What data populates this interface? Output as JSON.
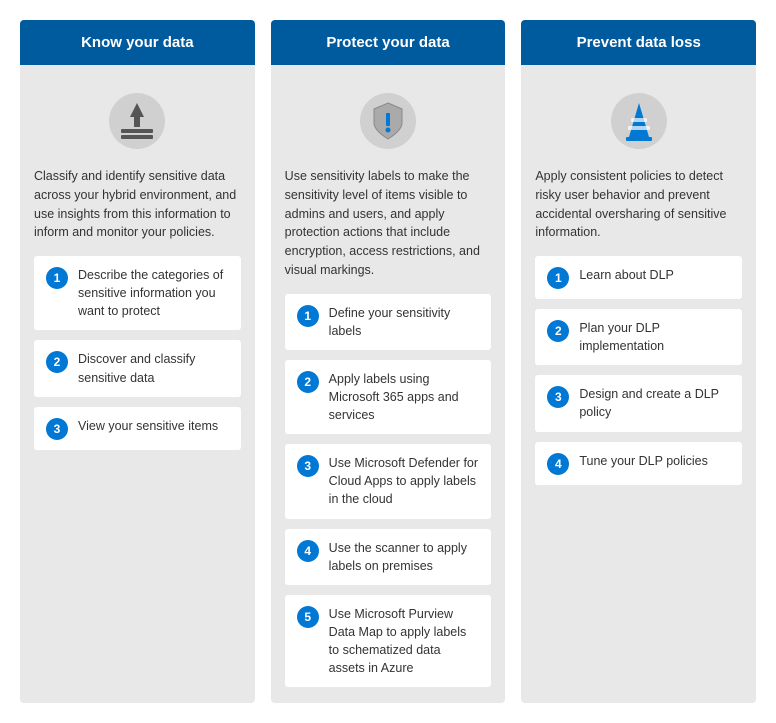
{
  "columns": [
    {
      "id": "know",
      "header": "Know your data",
      "description": "Classify and identify sensitive data across your hybrid environment, and use insights from this information to inform and monitor your policies.",
      "icon": "know-icon",
      "steps": [
        {
          "number": "1",
          "text": "Describe the categories of sensitive information you want to protect"
        },
        {
          "number": "2",
          "text": "Discover and classify sensitive data"
        },
        {
          "number": "3",
          "text": "View your sensitive items"
        }
      ]
    },
    {
      "id": "protect",
      "header": "Protect your data",
      "description": "Use sensitivity labels to make the sensitivity level of items visible to admins and users, and apply protection actions that include encryption, access restrictions, and visual markings.",
      "icon": "protect-icon",
      "steps": [
        {
          "number": "1",
          "text": "Define your sensitivity labels"
        },
        {
          "number": "2",
          "text": "Apply labels using Microsoft 365 apps and services"
        },
        {
          "number": "3",
          "text": "Use Microsoft Defender for Cloud Apps to apply labels in the cloud"
        },
        {
          "number": "4",
          "text": "Use the scanner to apply labels on premises"
        },
        {
          "number": "5",
          "text": "Use Microsoft Purview Data Map to apply labels to schematized data assets in Azure"
        }
      ]
    },
    {
      "id": "prevent",
      "header": "Prevent data loss",
      "description": "Apply consistent policies to detect risky user behavior and prevent accidental oversharing of sensitive information.",
      "icon": "prevent-icon",
      "steps": [
        {
          "number": "1",
          "text": "Learn about DLP"
        },
        {
          "number": "2",
          "text": "Plan your DLP implementation"
        },
        {
          "number": "3",
          "text": "Design and create a DLP policy"
        },
        {
          "number": "4",
          "text": "Tune your DLP policies"
        }
      ]
    }
  ]
}
